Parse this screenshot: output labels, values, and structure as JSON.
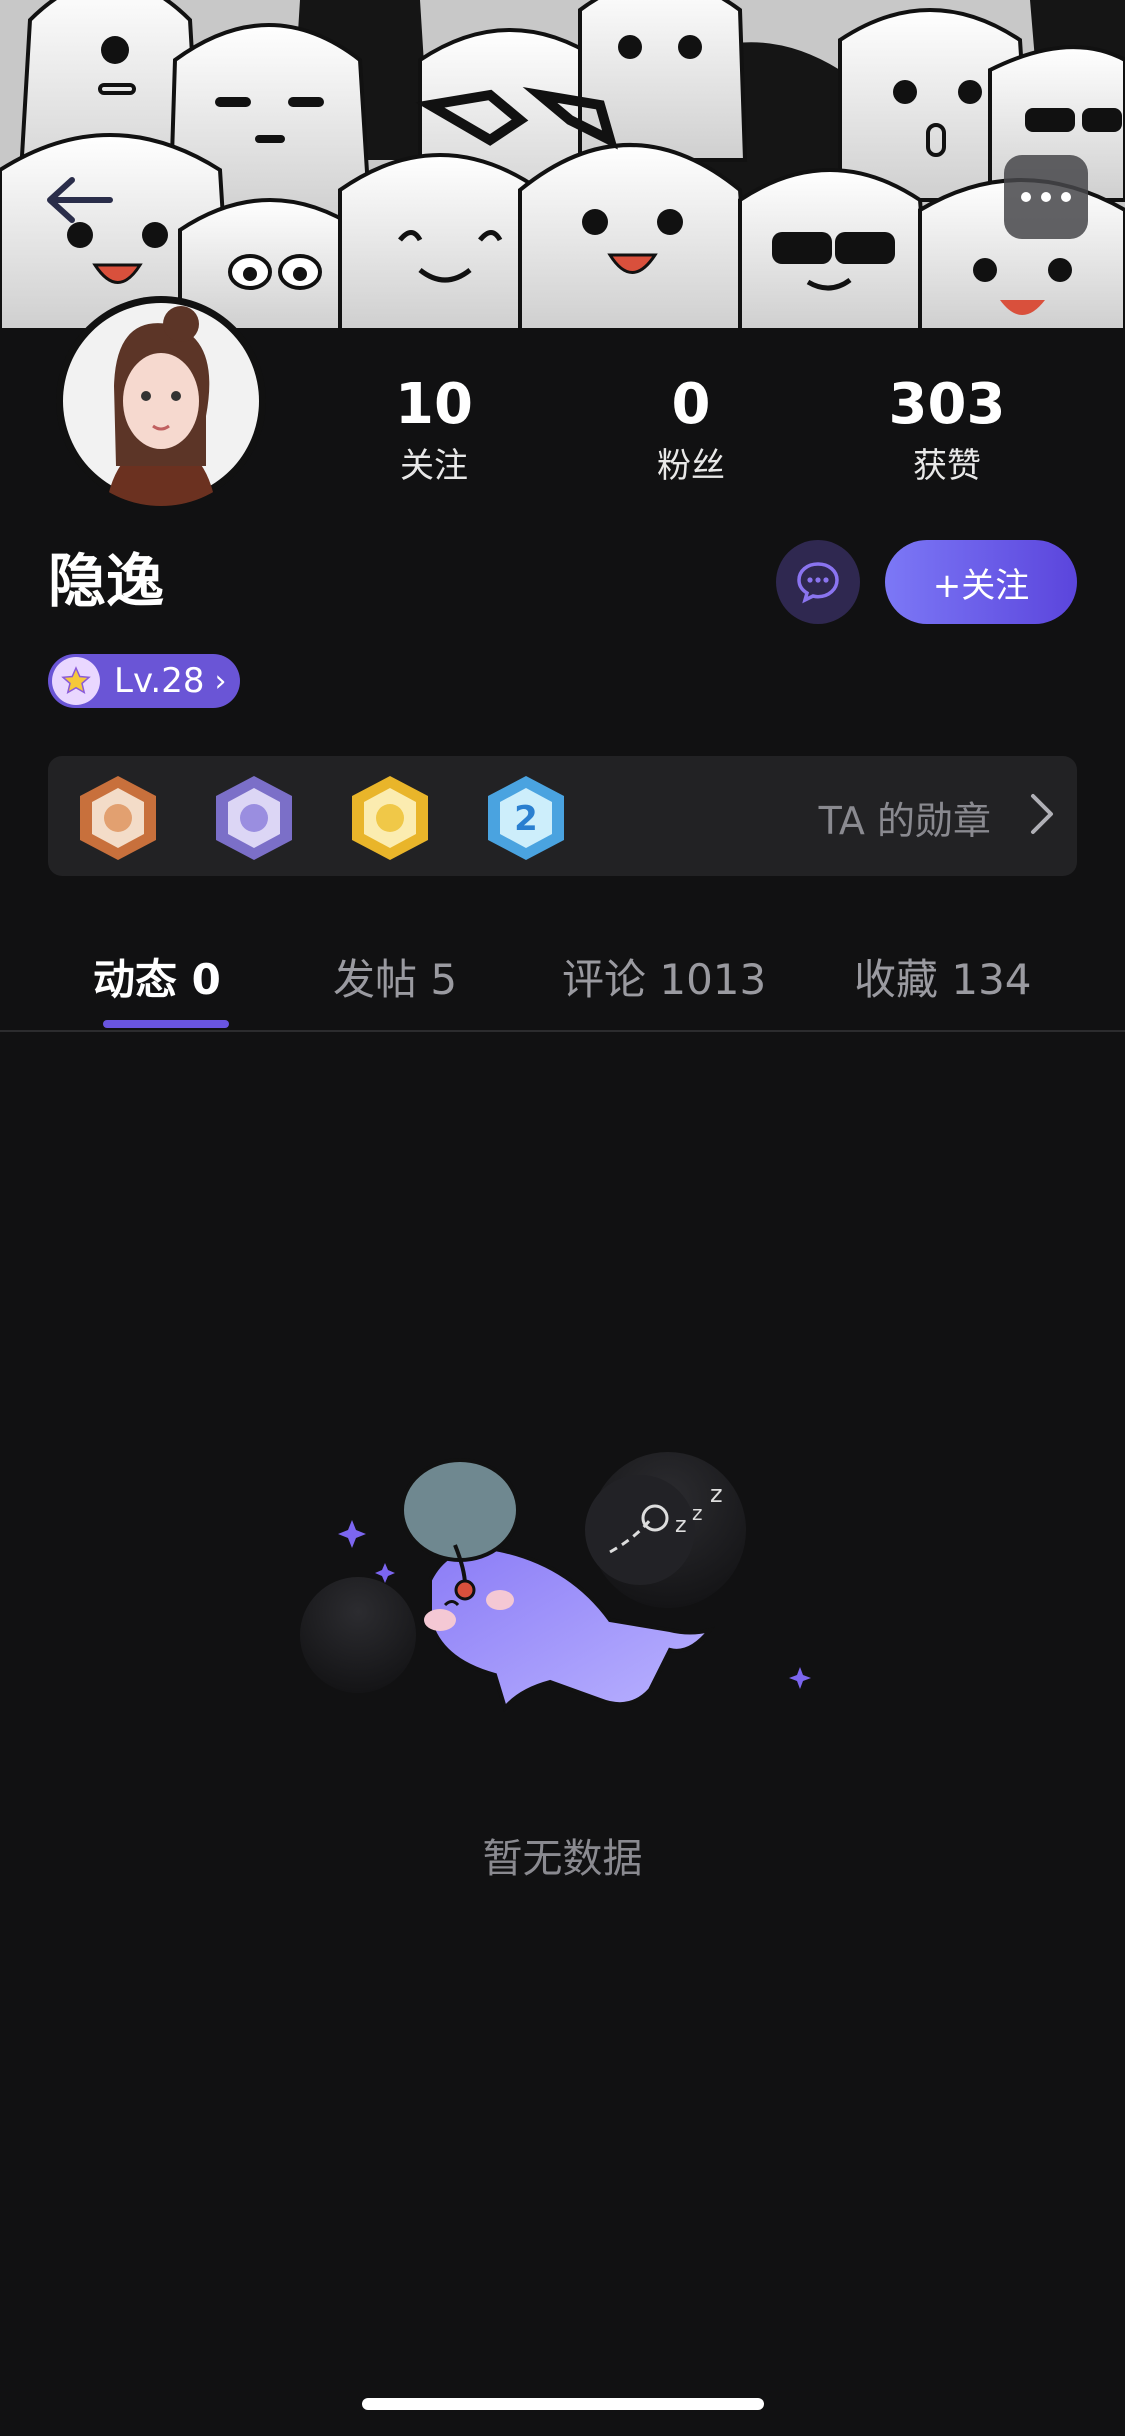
{
  "header": {
    "back_icon": "arrow-left-icon",
    "more_icon": "ellipsis-icon"
  },
  "profile": {
    "username": "隐逸",
    "level_label": "Lv.28",
    "stats": [
      {
        "value": "10",
        "label": "关注"
      },
      {
        "value": "0",
        "label": "粉丝"
      },
      {
        "value": "303",
        "label": "获赞"
      }
    ],
    "follow_label": "+关注",
    "message_icon": "chat-bubble-icon"
  },
  "badges": {
    "label": "TA 的勋章",
    "items": [
      "bronze-medal-icon",
      "silver-medal-icon",
      "gold-medal-icon",
      "anniversary-2-medal-icon"
    ]
  },
  "tabs": [
    {
      "label": "动态 0",
      "active": true
    },
    {
      "label": "发帖 5",
      "active": false
    },
    {
      "label": "评论 1013",
      "active": false
    },
    {
      "label": "收藏 134",
      "active": false
    }
  ],
  "empty_state": {
    "text": "暂无数据"
  },
  "colors": {
    "background": "#111112",
    "accent": "#6a55e0",
    "card": "#222224"
  }
}
